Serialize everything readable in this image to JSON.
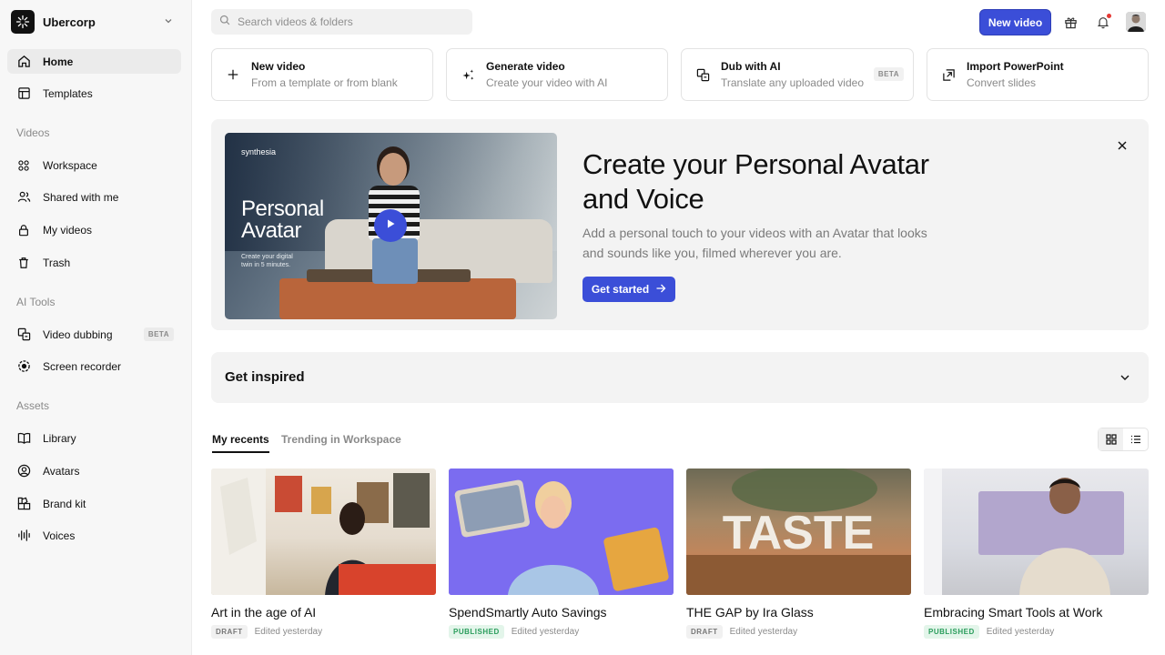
{
  "workspace": {
    "name": "Ubercorp"
  },
  "sidebar": {
    "items": [
      {
        "label": "Home",
        "icon": "home-icon"
      },
      {
        "label": "Templates",
        "icon": "templates-icon"
      }
    ],
    "videos_section": "Videos",
    "videos": [
      {
        "label": "Workspace",
        "icon": "workspace-icon"
      },
      {
        "label": "Shared with me",
        "icon": "users-icon"
      },
      {
        "label": "My videos",
        "icon": "lock-icon"
      },
      {
        "label": "Trash",
        "icon": "trash-icon"
      }
    ],
    "ai_section": "AI Tools",
    "ai": [
      {
        "label": "Video dubbing",
        "icon": "dubbing-icon",
        "badge": "BETA"
      },
      {
        "label": "Screen recorder",
        "icon": "record-icon"
      }
    ],
    "assets_section": "Assets",
    "assets": [
      {
        "label": "Library",
        "icon": "book-icon"
      },
      {
        "label": "Avatars",
        "icon": "avatar-icon"
      },
      {
        "label": "Brand kit",
        "icon": "brand-kit-icon"
      },
      {
        "label": "Voices",
        "icon": "waveform-icon"
      }
    ]
  },
  "topbar": {
    "search_placeholder": "Search videos & folders",
    "new_video": "New video"
  },
  "actions": [
    {
      "title": "New video",
      "subtitle": "From a template or from blank",
      "icon": "plus-icon"
    },
    {
      "title": "Generate video",
      "subtitle": "Create your video with AI",
      "icon": "sparkle-icon"
    },
    {
      "title": "Dub with AI",
      "subtitle": "Translate any uploaded video",
      "icon": "dubbing-icon",
      "badge": "BETA"
    },
    {
      "title": "Import PowerPoint",
      "subtitle": "Convert slides",
      "icon": "import-icon"
    }
  ],
  "hero": {
    "thumb_brand": "synthesia",
    "thumb_title_1": "Personal",
    "thumb_title_2": "Avatar",
    "thumb_caption": "Create your digital twin in 5 minutes.",
    "title": "Create your Personal Avatar and Voice",
    "subtitle": "Add a personal touch to your videos with an Avatar that looks and sounds like you, filmed wherever you are.",
    "cta": "Get started"
  },
  "inspired": {
    "title": "Get inspired"
  },
  "tabs": {
    "recents": "My recents",
    "trending": "Trending in Workspace"
  },
  "videos": [
    {
      "title": "Art in the age of AI",
      "status": "DRAFT",
      "edited": "Edited yesterday"
    },
    {
      "title": "SpendSmartly Auto Savings",
      "status": "PUBLISHED",
      "edited": "Edited yesterday"
    },
    {
      "title": "THE GAP by Ira Glass",
      "status": "DRAFT",
      "edited": "Edited yesterday",
      "thumb_text": "TASTE"
    },
    {
      "title": "Embracing Smart Tools at Work",
      "status": "PUBLISHED",
      "edited": "Edited yesterday"
    }
  ],
  "colors": {
    "accent": "#3b4ed8",
    "published": "#2a9d5c",
    "draft": "#777777"
  }
}
